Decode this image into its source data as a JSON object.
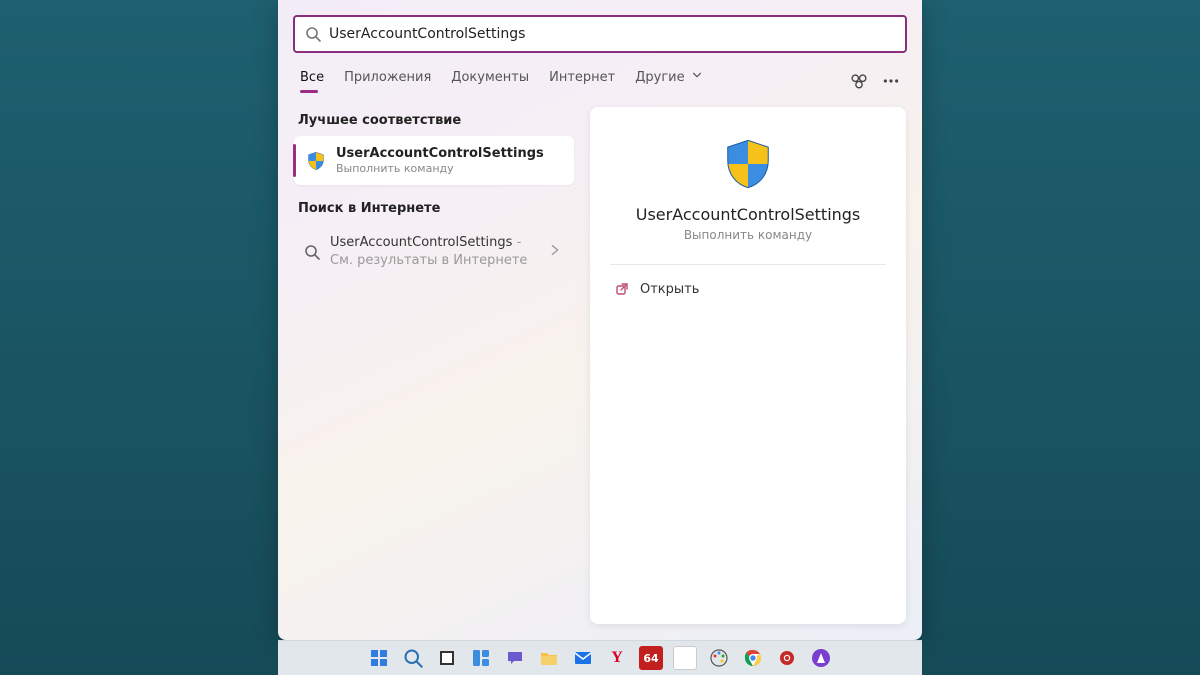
{
  "search": {
    "query": "UserAccountControlSettings"
  },
  "tabs": {
    "items": [
      "Все",
      "Приложения",
      "Документы",
      "Интернет",
      "Другие"
    ],
    "active": 0
  },
  "left": {
    "best_header": "Лучшее соответствие",
    "best_match": {
      "title": "UserAccountControlSettings",
      "subtitle": "Выполнить команду"
    },
    "web_header": "Поиск в Интернете",
    "web_result": {
      "title": "UserAccountControlSettings",
      "suffix": " - См. результаты в Интернете"
    }
  },
  "detail": {
    "title": "UserAccountControlSettings",
    "subtitle": "Выполнить команду",
    "action_open": "Открыть"
  },
  "icons": {
    "search": "search-icon",
    "shield": "uac-shield-icon",
    "chevron_right": "chevron-right-icon",
    "chevron_down": "chevron-down-icon",
    "open_external": "open-external-icon",
    "chat_switch": "chat-switch-icon",
    "more": "more-icon"
  },
  "taskbar": [
    {
      "name": "start-icon",
      "label": "Start"
    },
    {
      "name": "search-icon",
      "label": "Search"
    },
    {
      "name": "task-view-icon",
      "label": "Task View"
    },
    {
      "name": "widgets-icon",
      "label": "Widgets"
    },
    {
      "name": "chat-icon",
      "label": "Chat"
    },
    {
      "name": "file-explorer-icon",
      "label": "Explorer"
    },
    {
      "name": "mail-icon",
      "label": "Mail"
    },
    {
      "name": "yandex-icon",
      "label": "Yandex"
    },
    {
      "name": "aida64-icon",
      "label": "AIDA64"
    },
    {
      "name": "document-icon",
      "label": "Document"
    },
    {
      "name": "paint-icon",
      "label": "Paint"
    },
    {
      "name": "chrome-icon",
      "label": "Chrome"
    },
    {
      "name": "record-icon",
      "label": "Record"
    },
    {
      "name": "alice-icon",
      "label": "Alice"
    }
  ],
  "colors": {
    "accent": "#9b2e84",
    "shield_blue": "#3a8de0",
    "shield_yellow": "#f6c21a"
  }
}
